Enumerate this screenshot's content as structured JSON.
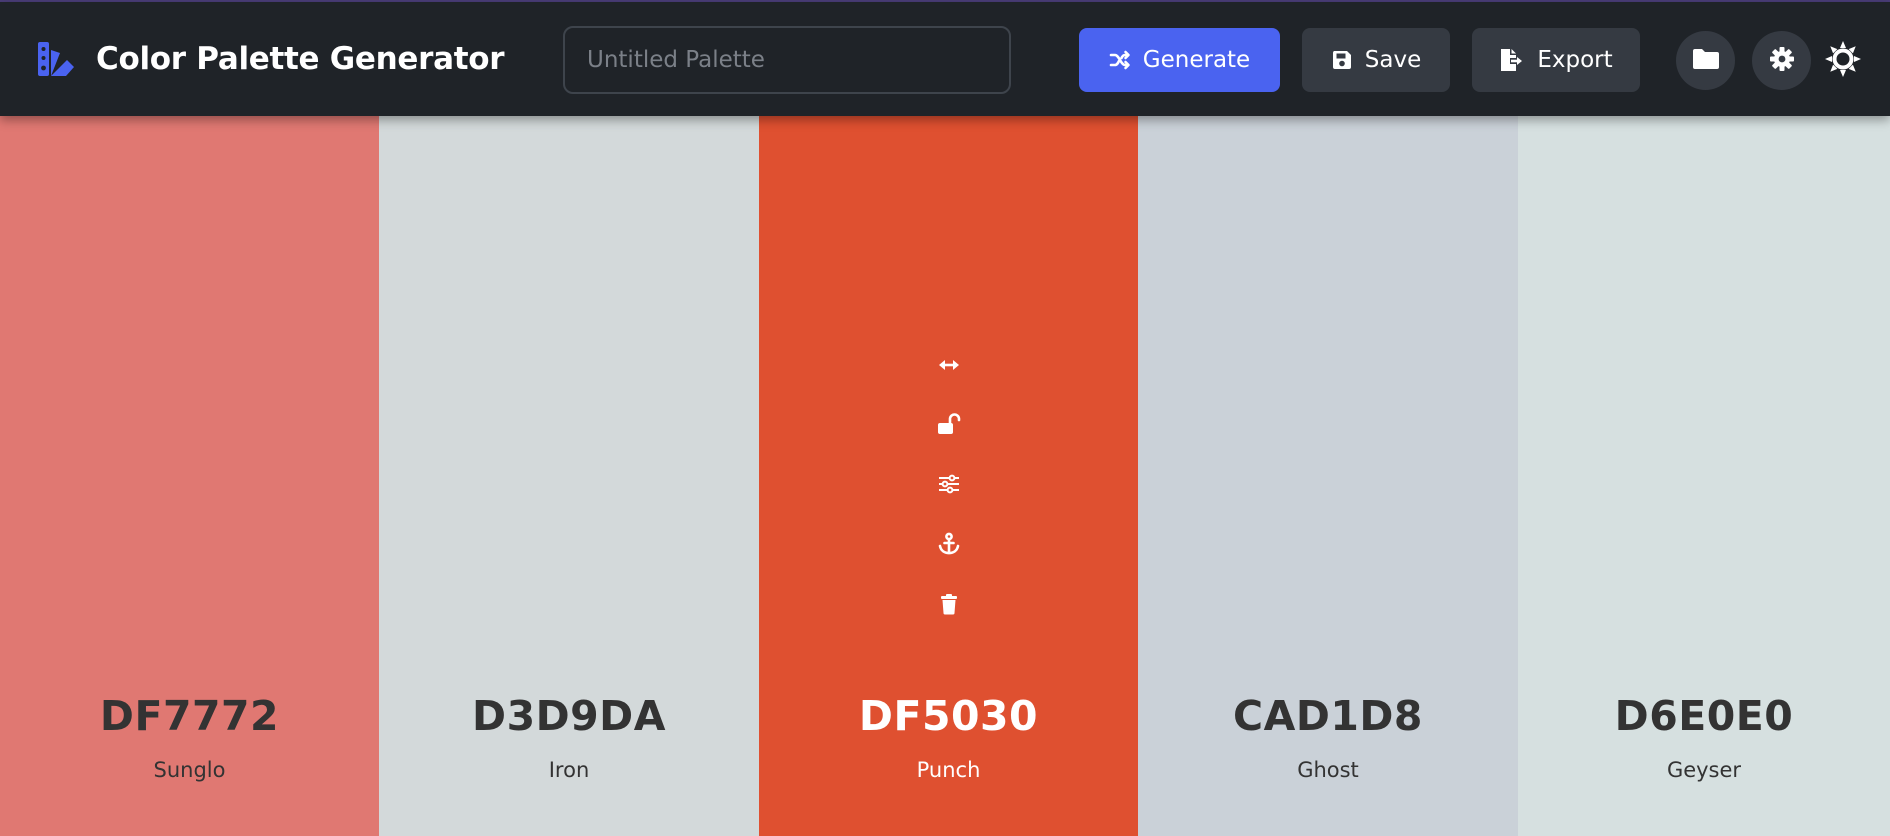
{
  "app": {
    "title": "Color Palette Generator",
    "accent": "#4a63f0"
  },
  "toolbar": {
    "palette_name_value": "",
    "palette_name_placeholder": "Untitled Palette",
    "generate_label": "Generate",
    "save_label": "Save",
    "export_label": "Export",
    "icons": [
      "shuffle-icon",
      "save-icon",
      "export-icon",
      "folder-icon",
      "gear-icon",
      "sun-icon"
    ]
  },
  "palette": {
    "colors": [
      {
        "hex": "DF7772",
        "name": "Sunglo",
        "bg": "#e07872",
        "text": "#333333"
      },
      {
        "hex": "D3D9DA",
        "name": "Iron",
        "bg": "#d3d9da",
        "text": "#333333"
      },
      {
        "hex": "DF5030",
        "name": "Punch",
        "bg": "#df5030",
        "text": "#ffffff"
      },
      {
        "hex": "CAD1D8",
        "name": "Ghost",
        "bg": "#cad1d8",
        "text": "#333333"
      },
      {
        "hex": "D6E0E0",
        "name": "Geyser",
        "bg": "#d6e0e0",
        "text": "#333333"
      }
    ],
    "hovered_index": 2,
    "swatch_tools": [
      "drag-icon",
      "unlock-icon",
      "sliders-icon",
      "anchor-icon",
      "trash-icon"
    ]
  }
}
